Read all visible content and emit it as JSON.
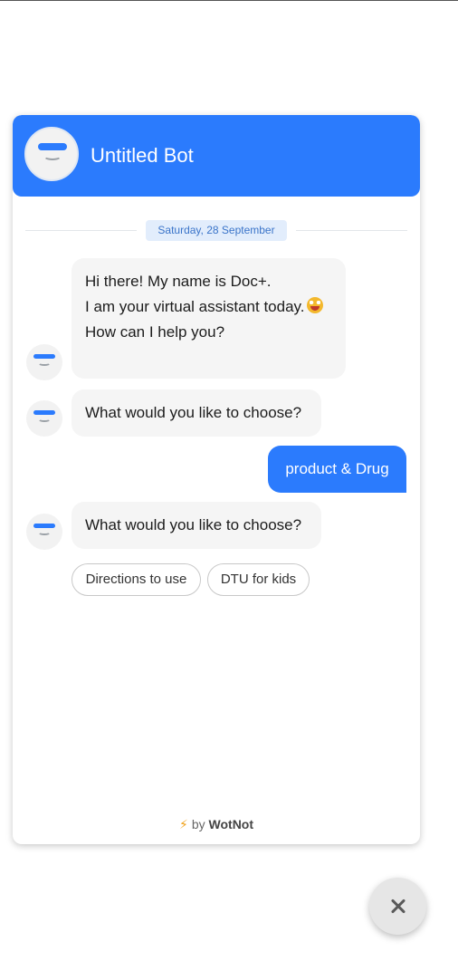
{
  "header": {
    "bot_name": "Untitled Bot"
  },
  "date_divider": "Saturday, 28 September",
  "messages": [
    {
      "from": "bot",
      "lines": [
        "Hi there! My name is Doc+.",
        "I am your virtual assistant today.",
        "How can I help you?"
      ],
      "emoji": "grinning-face-with-tongue"
    },
    {
      "from": "bot",
      "text": "What would you like to choose?"
    },
    {
      "from": "user",
      "text": "product & Drug"
    },
    {
      "from": "bot",
      "text": "What would you like to choose?"
    }
  ],
  "options": [
    "Directions to use",
    "DTU for kids"
  ],
  "footer": {
    "prefix": "by",
    "brand": "WotNot"
  },
  "colors": {
    "accent": "#2b7bfd",
    "bot_bubble": "#f5f5f5",
    "date_chip_bg": "#e2edfc",
    "date_chip_text": "#3a74c9",
    "bolt": "#f0a21b"
  }
}
